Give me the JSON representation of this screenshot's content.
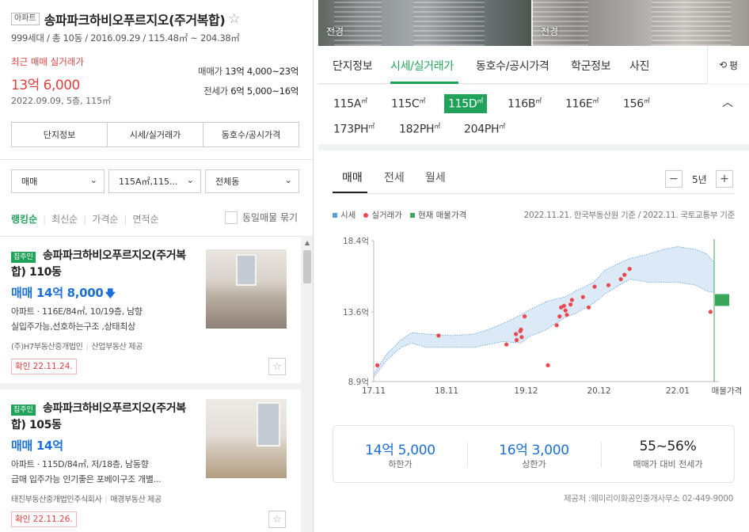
{
  "complex": {
    "badge": "아파트",
    "name": "송파파크하비오푸르지오(주거복합)",
    "subinfo": "999세대 / 총 10동 / 2016.09.29 / 115.48㎡ ~ 204.38㎡",
    "recent_label": "최근 매매 실거래가",
    "recent_price": "13억 6,000",
    "recent_date": "2022.09.09, 5층, 115㎡",
    "sale_range_label": "매매가",
    "sale_range": "13억 4,000~23억",
    "lease_range_label": "전세가",
    "lease_range": "6억 5,000~16억"
  },
  "left_tabs": [
    "단지정보",
    "시세/실거래가",
    "동호수/공시가격"
  ],
  "filters": {
    "trade_type": "매매",
    "area": "115A㎡,115...",
    "building": "전체동"
  },
  "sort": {
    "items": [
      "랭킹순",
      "최신순",
      "가격순",
      "면적순"
    ],
    "active": 0,
    "dup_label": "동일매물 묶기"
  },
  "listings": [
    {
      "badge": "집주인",
      "title": "송파파크하비오푸르지오(주거복합) 110동",
      "price": "매매 14억 8,000",
      "spec": "아파트 · 116E/84㎡, 10/19층, 남향",
      "desc": "실입주가능,선호하는구조 ,상태최상",
      "agent": "(주)H7부동산중개법인",
      "provider": "산업부동산 제공",
      "confirm": "확인 22.11.24."
    },
    {
      "badge": "집주인",
      "title": "송파파크하비오푸르지오(주거복합) 105동",
      "price": "매매 14억",
      "spec": "아파트 · 115D/84㎡, 저/18층, 남동향",
      "desc": "급매 입주가능 인기좋은 포베이구조 개별...",
      "agent": "태진부동산중개법인주식회사",
      "provider": "매경부동산 제공",
      "confirm": "확인 22.11.26."
    }
  ],
  "photos": [
    "전경",
    "전경"
  ],
  "right_tabs": [
    "단지정보",
    "시세/실거래가",
    "동호수/공시가격",
    "학군정보",
    "사진"
  ],
  "right_tab_active": 1,
  "refresh_label": "평",
  "areas": [
    {
      "label": "115A",
      "unit": "㎡"
    },
    {
      "label": "115C",
      "unit": "㎡"
    },
    {
      "label": "115D",
      "unit": "㎡"
    },
    {
      "label": "116B",
      "unit": "㎡"
    },
    {
      "label": "116E",
      "unit": "㎡"
    },
    {
      "label": "156",
      "unit": "㎡"
    },
    {
      "label": "173PH",
      "unit": "㎡"
    },
    {
      "label": "182PH",
      "unit": "㎡"
    },
    {
      "label": "204PH",
      "unit": "㎡"
    }
  ],
  "area_active": 2,
  "chart_tabs": [
    "매매",
    "전세",
    "월세"
  ],
  "chart_tab_active": 0,
  "period": "5년",
  "legend": [
    "시세",
    "실거래가",
    "현재 매물가격"
  ],
  "source_note": "2022.11.21. 한국부동산원 기준 / 2022.11. 국토교통부 기준",
  "colors": {
    "accent": "#21a25a",
    "price_blue": "#1b6fd6",
    "red": "#e0403f",
    "band": "#dce9f7",
    "band_line": "#5a9bd8",
    "deal_dot": "#e84a4f"
  },
  "chart_data": {
    "type": "scatter",
    "title": "",
    "xlabel": "",
    "ylabel": "",
    "yticks": [
      "18.4억",
      "13.6억",
      "8.9억"
    ],
    "ytick_values": [
      18.4,
      13.6,
      8.9
    ],
    "ylim": [
      8.9,
      18.4
    ],
    "xticks": [
      "17.11",
      "18.11",
      "19.12",
      "20.12",
      "22.01",
      "매물가격"
    ],
    "xtick_values": [
      2017.83,
      2018.83,
      2019.92,
      2020.92,
      2022.0
    ],
    "xlim": [
      2017.83,
      2022.5
    ],
    "series": [
      {
        "name": "시세",
        "type": "band",
        "x": [
          2017.83,
          2018.0,
          2018.2,
          2018.35,
          2018.55,
          2018.9,
          2019.2,
          2019.4,
          2019.6,
          2019.85,
          2019.95,
          2020.2,
          2020.45,
          2020.6,
          2020.85,
          2021.0,
          2021.2,
          2021.35,
          2021.6,
          2021.8,
          2022.0,
          2022.25,
          2022.4,
          2022.5
        ],
        "low": [
          9.2,
          10.3,
          11.2,
          11.5,
          11.2,
          11.2,
          11.2,
          11.4,
          11.6,
          11.5,
          11.9,
          12.4,
          13.2,
          13.5,
          14.2,
          14.8,
          15.4,
          15.8,
          15.6,
          15.6,
          15.6,
          15.4,
          15.0,
          14.9
        ],
        "high": [
          9.4,
          10.7,
          11.7,
          12.2,
          12.1,
          12.0,
          12.1,
          12.4,
          12.8,
          13.4,
          13.7,
          14.3,
          14.6,
          15.0,
          15.6,
          16.4,
          16.9,
          17.2,
          17.5,
          17.8,
          18.0,
          17.8,
          17.5,
          16.9
        ]
      },
      {
        "name": "실거래가",
        "type": "scatter",
        "x": [
          2017.88,
          2018.72,
          2019.65,
          2019.78,
          2019.79,
          2019.84,
          2019.85,
          2019.86,
          2019.9,
          2020.22,
          2020.34,
          2020.38,
          2020.4,
          2020.44,
          2020.46,
          2020.48,
          2020.53,
          2020.55,
          2020.7,
          2020.78,
          2020.86,
          2021.05,
          2021.22,
          2021.27,
          2021.34,
          2022.45
        ],
        "y": [
          10.0,
          12.0,
          11.4,
          12.1,
          11.7,
          12.3,
          12.4,
          11.9,
          13.3,
          10.0,
          12.7,
          13.3,
          13.9,
          14.0,
          13.7,
          13.4,
          14.1,
          14.4,
          14.6,
          13.9,
          15.3,
          15.4,
          15.8,
          16.1,
          16.5,
          13.6
        ]
      },
      {
        "name": "현재 매물가격",
        "type": "range",
        "x": 2022.5,
        "low": 14.0,
        "high": 14.8
      }
    ],
    "grid": false,
    "legend_position": "top-left"
  },
  "stats": [
    {
      "value": "14억 5,000",
      "label": "하한가"
    },
    {
      "value": "16억 3,000",
      "label": "상한가"
    },
    {
      "value": "55~56%",
      "label": "매매가 대비 전세가"
    }
  ],
  "provider_note": "제공처 :웨미리이화공인중개사무소 02-449-9000"
}
